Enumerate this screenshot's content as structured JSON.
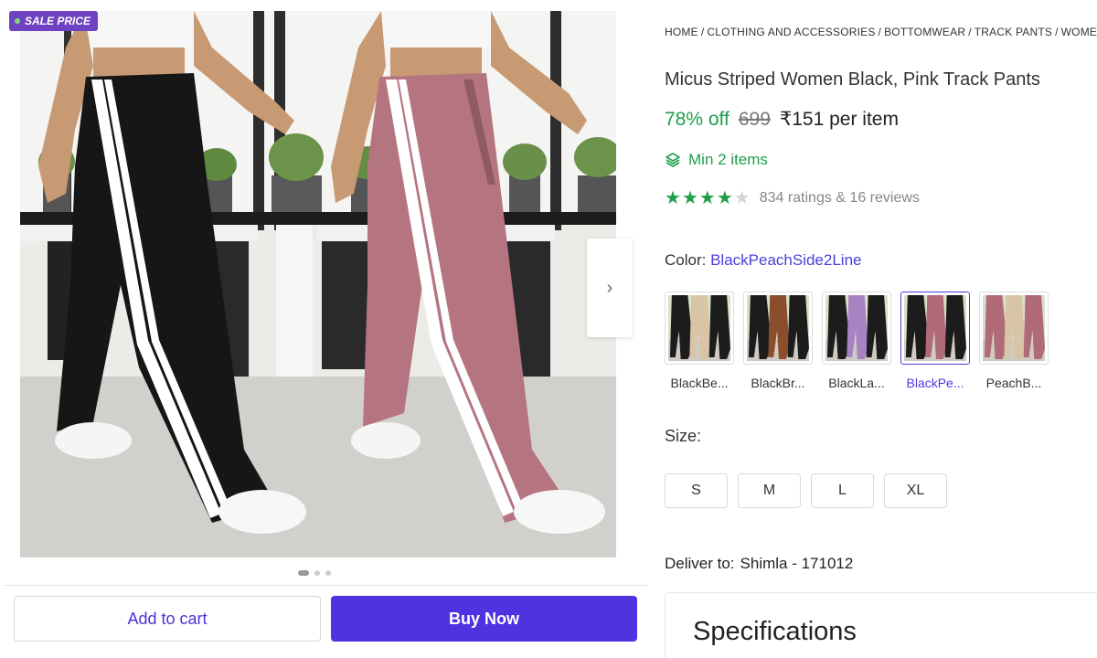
{
  "badge": {
    "label": "SALE PRICE"
  },
  "gallery": {
    "next_icon": "chevron-right-icon",
    "dots": 3,
    "active_dot": 0
  },
  "actions": {
    "add_to_cart": "Add to cart",
    "buy_now": "Buy Now"
  },
  "breadcrumb": [
    "HOME",
    "CLOTHING AND ACCESSORIES",
    "BOTTOMWEAR",
    "TRACK PANTS",
    "WOMEN"
  ],
  "product": {
    "title": "Micus Striped Women Black, Pink Track Pants",
    "discount": "78% off",
    "mrp": "699",
    "price": "₹151 per item",
    "min_items": "Min 2 items",
    "min_items_icon": "layers-icon",
    "rating": 4,
    "rating_max": 5,
    "ratings_text": "834 ratings  & 16 reviews"
  },
  "color": {
    "label": "Color:",
    "selected": "BlackPeachSide2Line",
    "options": [
      {
        "label": "BlackBe...",
        "colors": [
          "#1c1c1c",
          "#d8c4a6"
        ]
      },
      {
        "label": "BlackBr...",
        "colors": [
          "#1c1c1c",
          "#8a4e2c"
        ]
      },
      {
        "label": "BlackLa...",
        "colors": [
          "#1c1c1c",
          "#a982c4"
        ]
      },
      {
        "label": "BlackPe...",
        "colors": [
          "#1c1c1c",
          "#b06a78"
        ],
        "selected": true
      },
      {
        "label": "PeachB...",
        "colors": [
          "#b06a78",
          "#d8c4a6"
        ]
      }
    ]
  },
  "size": {
    "label": "Size:",
    "options": [
      "S",
      "M",
      "L",
      "XL"
    ]
  },
  "delivery": {
    "label": "Deliver to:",
    "location": "Shimla - 171012"
  },
  "specs": {
    "title": "Specifications"
  },
  "colors": {
    "accent": "#4d34e0",
    "green": "#1e9e4a",
    "badge": "#6f42c1"
  }
}
